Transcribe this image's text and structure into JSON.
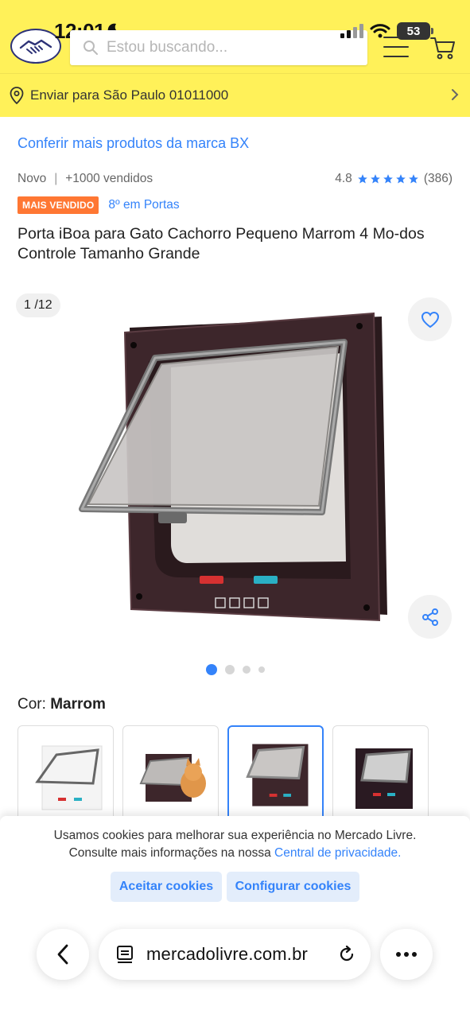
{
  "status_bar": {
    "time": "12:01",
    "battery": "53"
  },
  "header": {
    "search_placeholder": "Estou buscando...",
    "brand_color": "#fff159"
  },
  "shipping": {
    "label": "Enviar para São Paulo 01011000"
  },
  "product": {
    "brand_link": "Conferir mais produtos da marca BX",
    "condition": "Novo",
    "sold": "+1000 vendidos",
    "rating": "4.8",
    "reviews": "(386)",
    "badge": "MAIS VENDIDO",
    "rank": "8º em Portas",
    "title": "Porta iBoa para Gato Cachorro Pequeno Marrom 4 Mo-dos Controle Tamanho Grande"
  },
  "gallery": {
    "counter": "1 /12",
    "dots": 4,
    "active_dot": 1
  },
  "color": {
    "label": "Cor:",
    "value": "Marrom",
    "options": [
      "white-door",
      "brown-door-with-cat",
      "brown-door",
      "dark-door"
    ],
    "selected_index": 2
  },
  "cookie": {
    "text_line1": "Usamos cookies para melhorar sua experiência no Mercado Livre.",
    "text_line2": "Consulte mais informações na nossa",
    "link": "Central de privacidade.",
    "accept": "Aceitar cookies",
    "configure": "Configurar cookies"
  },
  "browser": {
    "url": "mercadolivre.com.br"
  },
  "colors": {
    "accent": "#3483fa",
    "badge": "#ff7733",
    "star": "#3483fa"
  }
}
